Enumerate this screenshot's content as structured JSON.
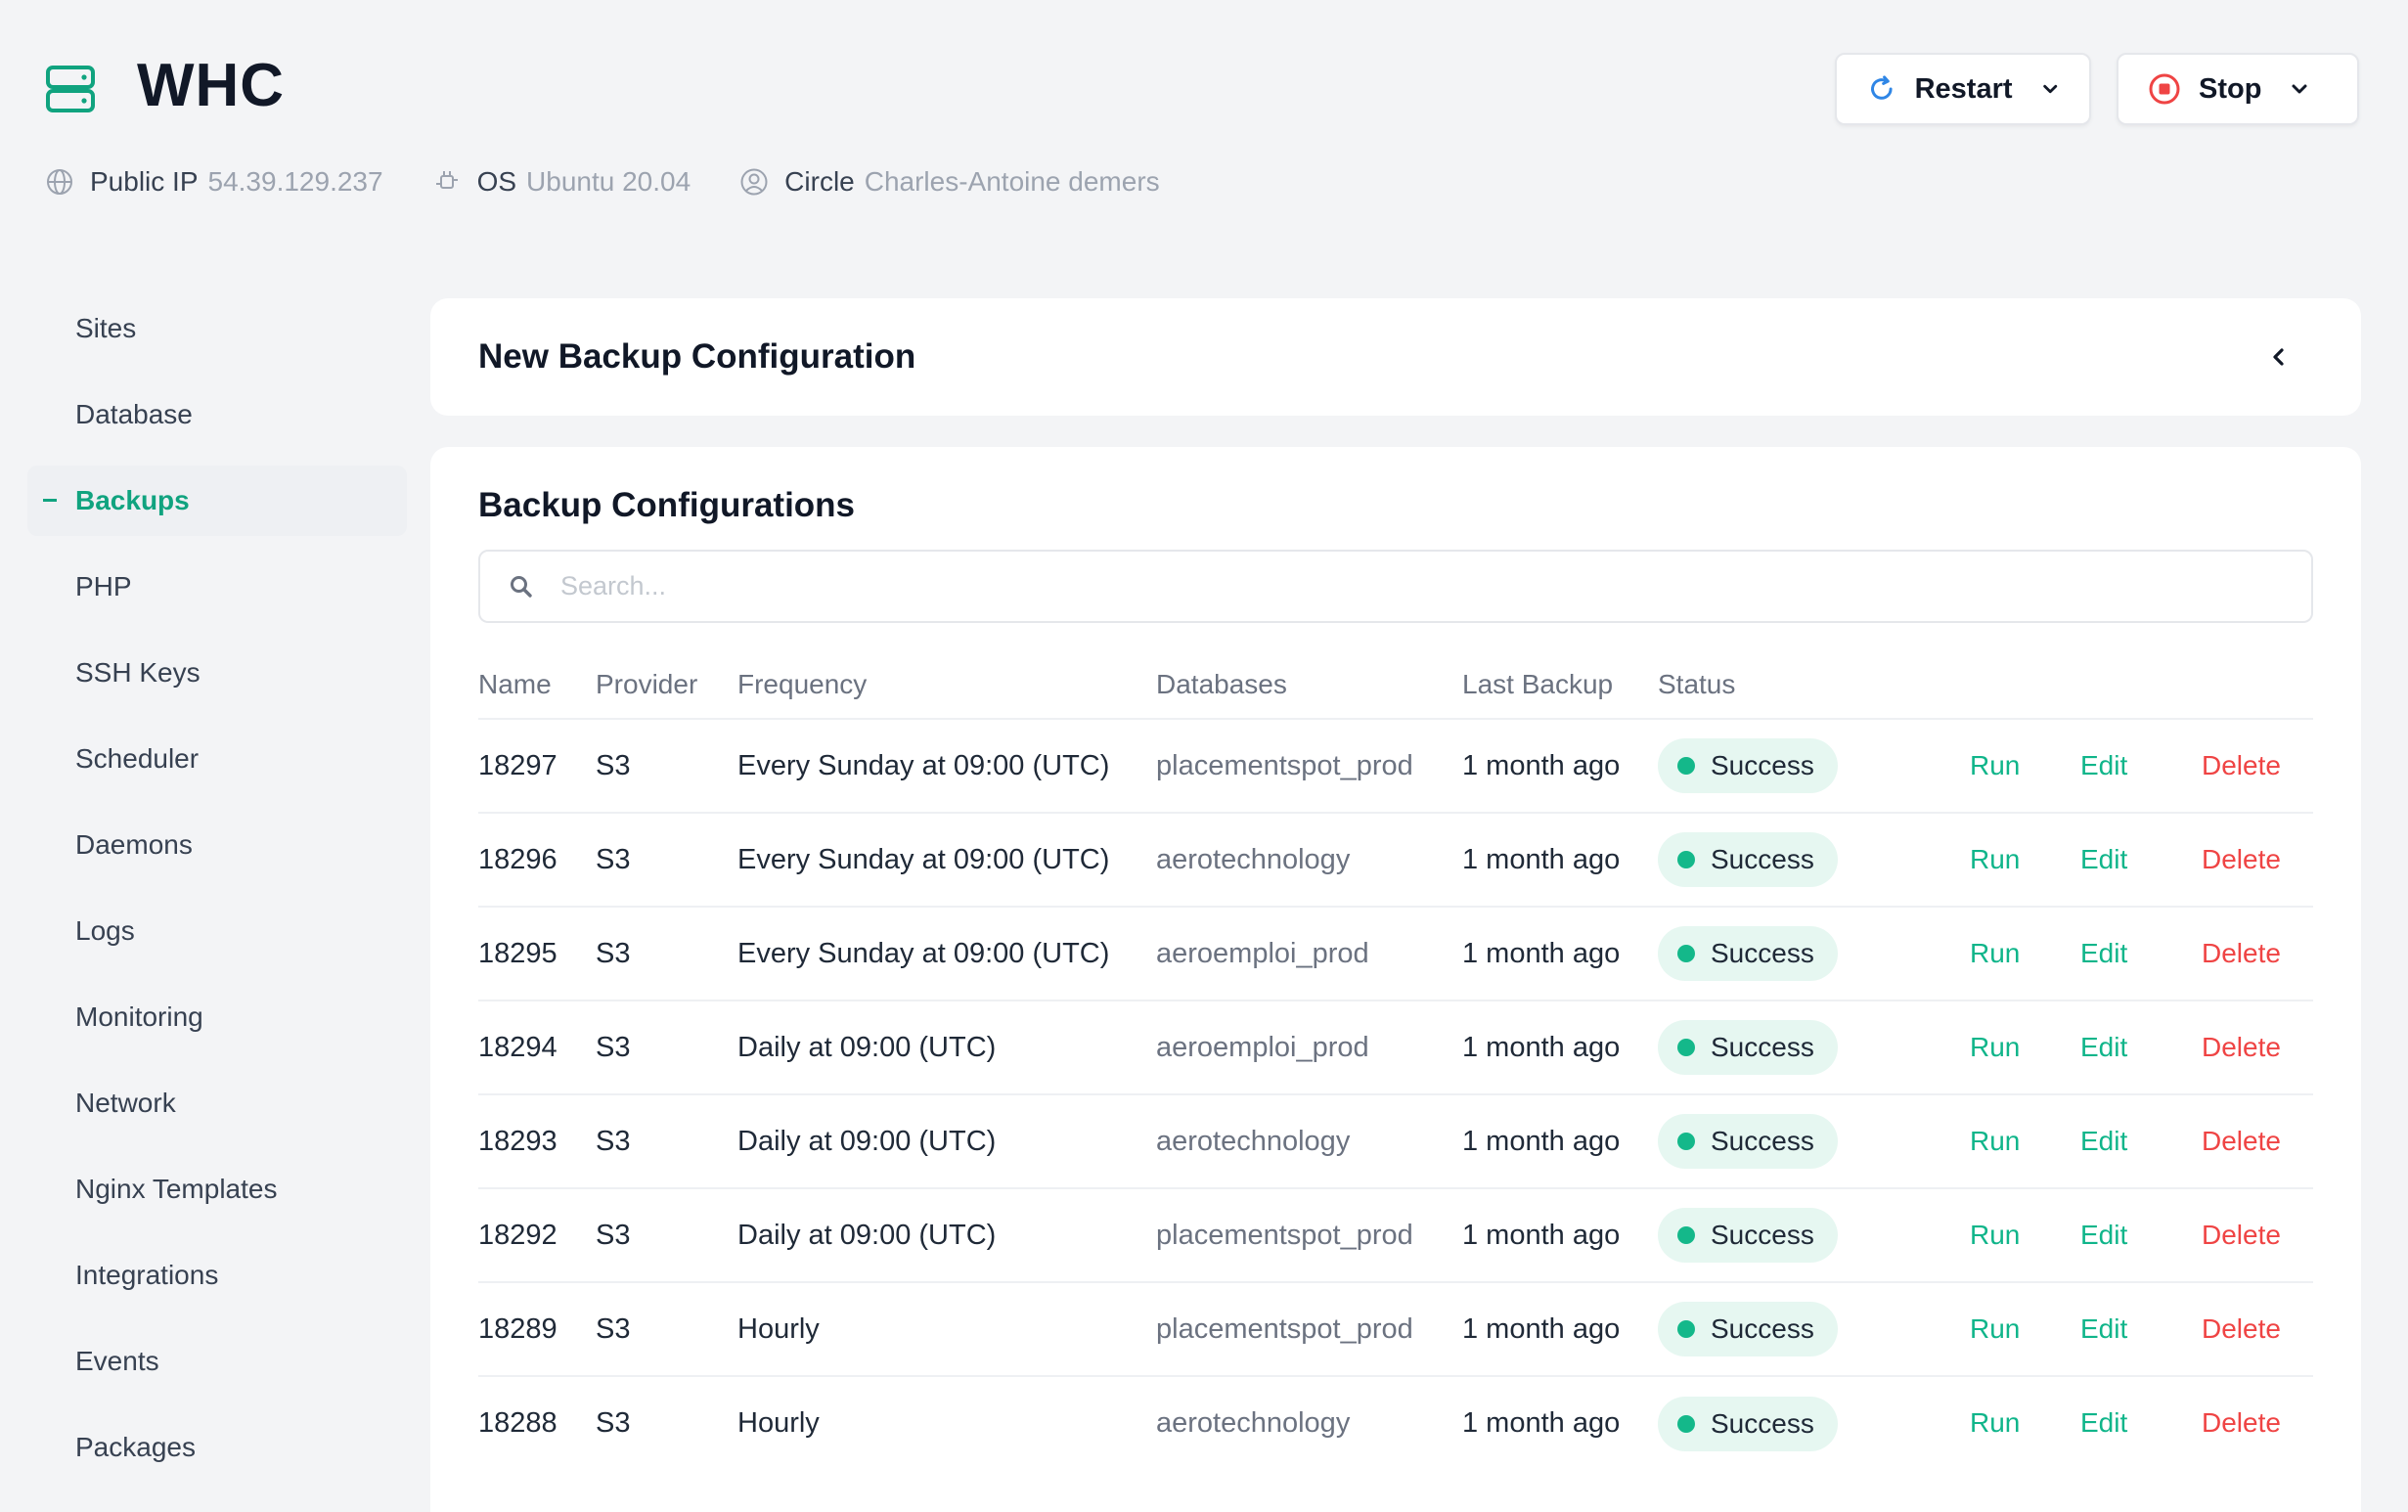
{
  "header": {
    "app_title": "WHC",
    "public_ip_label": "Public IP",
    "public_ip_value": "54.39.129.237",
    "os_label": "OS",
    "os_value": "Ubuntu 20.04",
    "circle_label": "Circle",
    "circle_value": "Charles-Antoine demers",
    "restart_label": "Restart",
    "stop_label": "Stop"
  },
  "sidebar": {
    "items": [
      {
        "label": "Sites"
      },
      {
        "label": "Database"
      },
      {
        "label": "Backups",
        "active": true
      },
      {
        "label": "PHP"
      },
      {
        "label": "SSH Keys"
      },
      {
        "label": "Scheduler"
      },
      {
        "label": "Daemons"
      },
      {
        "label": "Logs"
      },
      {
        "label": "Monitoring"
      },
      {
        "label": "Network"
      },
      {
        "label": "Nginx Templates"
      },
      {
        "label": "Integrations"
      },
      {
        "label": "Events"
      },
      {
        "label": "Packages"
      }
    ]
  },
  "new_backup": {
    "title": "New Backup Configuration"
  },
  "backup_list": {
    "title": "Backup Configurations",
    "search_placeholder": "Search...",
    "columns": [
      "Name",
      "Provider",
      "Frequency",
      "Databases",
      "Last Backup",
      "Status"
    ],
    "actions": {
      "run": "Run",
      "edit": "Edit",
      "delete": "Delete"
    },
    "rows": [
      {
        "name": "18297",
        "provider": "S3",
        "frequency": "Every Sunday at 09:00 (UTC)",
        "database": "placementspot_prod",
        "last_backup": "1 month ago",
        "status": "Success"
      },
      {
        "name": "18296",
        "provider": "S3",
        "frequency": "Every Sunday at 09:00 (UTC)",
        "database": "aerotechnology",
        "last_backup": "1 month ago",
        "status": "Success"
      },
      {
        "name": "18295",
        "provider": "S3",
        "frequency": "Every Sunday at 09:00 (UTC)",
        "database": "aeroemploi_prod",
        "last_backup": "1 month ago",
        "status": "Success"
      },
      {
        "name": "18294",
        "provider": "S3",
        "frequency": "Daily at 09:00 (UTC)",
        "database": "aeroemploi_prod",
        "last_backup": "1 month ago",
        "status": "Success"
      },
      {
        "name": "18293",
        "provider": "S3",
        "frequency": "Daily at 09:00 (UTC)",
        "database": "aerotechnology",
        "last_backup": "1 month ago",
        "status": "Success"
      },
      {
        "name": "18292",
        "provider": "S3",
        "frequency": "Daily at 09:00 (UTC)",
        "database": "placementspot_prod",
        "last_backup": "1 month ago",
        "status": "Success"
      },
      {
        "name": "18289",
        "provider": "S3",
        "frequency": "Hourly",
        "database": "placementspot_prod",
        "last_backup": "1 month ago",
        "status": "Success"
      },
      {
        "name": "18288",
        "provider": "S3",
        "frequency": "Hourly",
        "database": "aerotechnology",
        "last_backup": "1 month ago",
        "status": "Success"
      }
    ]
  },
  "colors": {
    "accent": "#10a37f",
    "danger": "#ef4444",
    "restart_icon": "#2f86e6",
    "stop_icon": "#ef4444"
  },
  "icons": [
    "server-icon",
    "globe-icon",
    "cpu-icon",
    "user-circle-icon",
    "refresh-icon",
    "stop-circle-icon",
    "chevron-down-icon",
    "chevron-left-icon",
    "search-icon"
  ]
}
